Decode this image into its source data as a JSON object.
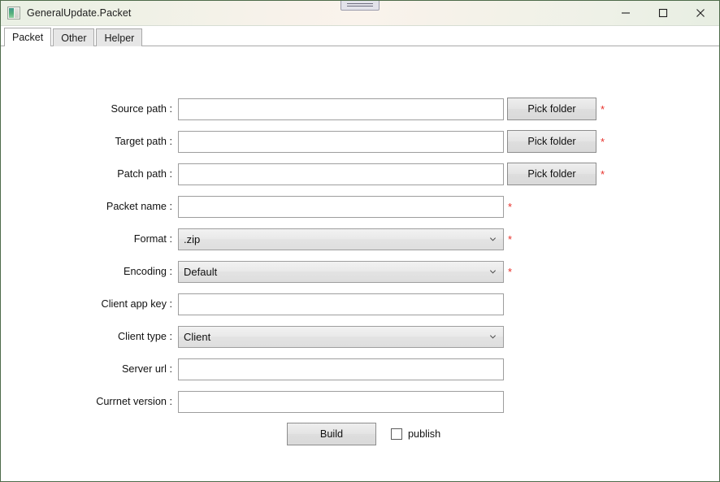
{
  "window": {
    "title": "GeneralUpdate.Packet",
    "app_icon": "app-window-icon",
    "snap_hint": "window-snap-indicator",
    "controls": {
      "minimize": "minimize-icon",
      "maximize": "maximize-icon",
      "close": "close-icon"
    },
    "accent_border": "#4e6b4a"
  },
  "tabs": [
    {
      "label": "Packet",
      "active": true
    },
    {
      "label": "Other",
      "active": false
    },
    {
      "label": "Helper",
      "active": false
    }
  ],
  "form": {
    "required_marker": "*",
    "required_color": "#e8302a",
    "rows": [
      {
        "label": "Source path :",
        "type": "text",
        "value": "",
        "placeholder": "",
        "button": "Pick folder",
        "required": true
      },
      {
        "label": "Target path :",
        "type": "text",
        "value": "",
        "placeholder": "",
        "button": "Pick folder",
        "required": true
      },
      {
        "label": "Patch path :",
        "type": "text",
        "value": "",
        "placeholder": "",
        "button": "Pick folder",
        "required": true
      },
      {
        "label": "Packet name :",
        "type": "text",
        "value": "",
        "placeholder": "",
        "button": "",
        "required": true
      },
      {
        "label": "Format :",
        "type": "combo",
        "value": ".zip",
        "button": "",
        "required": true
      },
      {
        "label": "Encoding :",
        "type": "combo",
        "value": "Default",
        "button": "",
        "required": true
      },
      {
        "label": "Client app key :",
        "type": "text",
        "value": "",
        "placeholder": "",
        "button": "",
        "required": false
      },
      {
        "label": "Client type :",
        "type": "combo",
        "value": "Client",
        "button": "",
        "required": false
      },
      {
        "label": "Server url :",
        "type": "text",
        "value": "",
        "placeholder": "",
        "button": "",
        "required": false
      },
      {
        "label": "Currnet version :",
        "type": "text",
        "value": "",
        "placeholder": "",
        "button": "",
        "required": false
      }
    ]
  },
  "actions": {
    "build_label": "Build",
    "publish_label": "publish",
    "publish_checked": false
  }
}
